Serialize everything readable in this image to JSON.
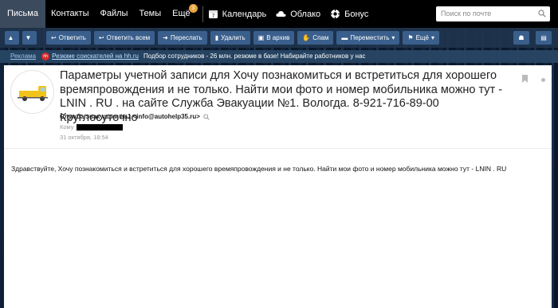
{
  "nav": {
    "items": [
      {
        "label": "Письма",
        "active": true
      },
      {
        "label": "Контакты"
      },
      {
        "label": "Файлы"
      },
      {
        "label": "Темы"
      },
      {
        "label": "Ещё",
        "badge": "3"
      }
    ],
    "services": [
      {
        "label": "Календарь",
        "icon": "calendar-icon"
      },
      {
        "label": "Облако",
        "icon": "cloud-icon"
      },
      {
        "label": "Бонус",
        "icon": "gear-bonus-icon"
      }
    ],
    "search_placeholder": "Поиск по почте"
  },
  "toolbar": {
    "reply": "Ответить",
    "reply_all": "Ответить всем",
    "forward": "Переслать",
    "delete": "Удалить",
    "archive": "В архив",
    "spam": "Спам",
    "move": "Переместить",
    "more": "Ещё"
  },
  "ad": {
    "label": "Реклама",
    "link": "Резюме соискателей на hh.ru",
    "text": "Подбор сотрудников - 26 млн. резюме в базе! Набирайте работников у нас"
  },
  "message": {
    "subject": "Параметры учетной записи для Хочу познакомиться и встретиться для хорошего времяпровождения и не только. Найти мои фото и номер мобильника можно тут - LNIN . RU . на сайте Служба Эвакуации №1. Вологда. 8-921-716-89-00 Круглосуточно",
    "sender": "Служба эвакуации №1 <info@autohelp35.ru>",
    "to_label": "Кому",
    "date": "31 октября, 18:54",
    "body": "Здравствуйте, Хочу познакомиться и встретиться для хорошего времяпровождения и не только. Найти мои фото и номер мобильника можно тут - LNIN . RU"
  },
  "colors": {
    "accent": "#3a5f8c",
    "topbar": "#000000",
    "badge": "#e8a33a",
    "truck": "#f2c31b"
  }
}
